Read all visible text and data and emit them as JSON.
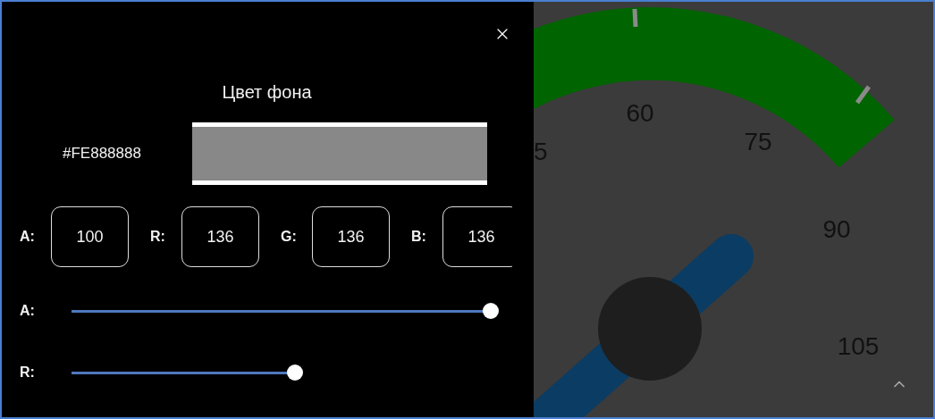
{
  "dialog": {
    "title": "Цвет фона",
    "hex": "#FE888888",
    "swatch": {
      "color": "#888888"
    },
    "channels": [
      {
        "label": "A:",
        "value": "100"
      },
      {
        "label": "R:",
        "value": "136"
      },
      {
        "label": "G:",
        "value": "136"
      },
      {
        "label": "B:",
        "value": "136"
      }
    ],
    "sliders": [
      {
        "label": "A:",
        "level": 1
      },
      {
        "label": "R:",
        "level": 0.533
      }
    ]
  },
  "gauge": {
    "labels": [
      "5",
      "60",
      "75",
      "90",
      "105"
    ]
  }
}
